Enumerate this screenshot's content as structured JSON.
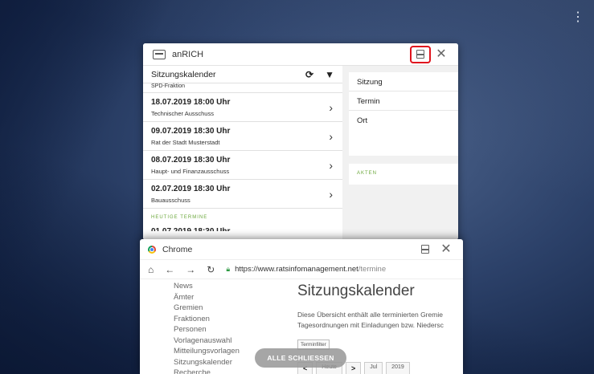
{
  "desktop": {
    "menu_icon": "more-vert-icon"
  },
  "anrich_window": {
    "title": "anRICH",
    "left_pane": {
      "header_label": "Sitzungskalender",
      "refresh_icon": "refresh-icon",
      "filter_icon": "filter-icon",
      "partial_top_item": "SPD-Fraktion",
      "items": [
        {
          "date": "18.07.2019 18:00 Uhr",
          "body": "Technischer Ausschuss"
        },
        {
          "date": "09.07.2019 18:30 Uhr",
          "body": "Rat der Stadt Musterstadt"
        },
        {
          "date": "08.07.2019 18:30 Uhr",
          "body": "Haupt- und Finanzausschuss"
        },
        {
          "date": "02.07.2019 18:30 Uhr",
          "body": "Bauausschuss"
        }
      ],
      "section_label": "HEUTIGE TERMINE",
      "partial_bottom_item": "01.07.2019 18:30 Uhr"
    },
    "right_pane": {
      "rows": [
        "Sitzung",
        "Termin",
        "Ort"
      ],
      "akten_label": "AKTEN"
    }
  },
  "chrome_window": {
    "title": "Chrome",
    "url_host": "https://www.ratsinfomanagement.net",
    "url_path": "/termine",
    "nav_items": [
      "News",
      "Ämter",
      "Gremien",
      "Fraktionen",
      "Personen",
      "Vorlagenauswahl",
      "Mitteilungsvorlagen",
      "Sitzungskalender",
      "Recherche"
    ],
    "page_title": "Sitzungskalender",
    "desc_line1": "Diese Übersicht enthält alle terminierten Gremie",
    "desc_line2": "Tagesordnungen mit Einladungen bzw. Niedersc",
    "filter_label": "Terminfilter",
    "pager": {
      "prev": "<",
      "today": "Heute",
      "next": ">",
      "month": "Jul",
      "year": "2019"
    }
  },
  "close_all_label": "ALLE SCHLIESSEN"
}
